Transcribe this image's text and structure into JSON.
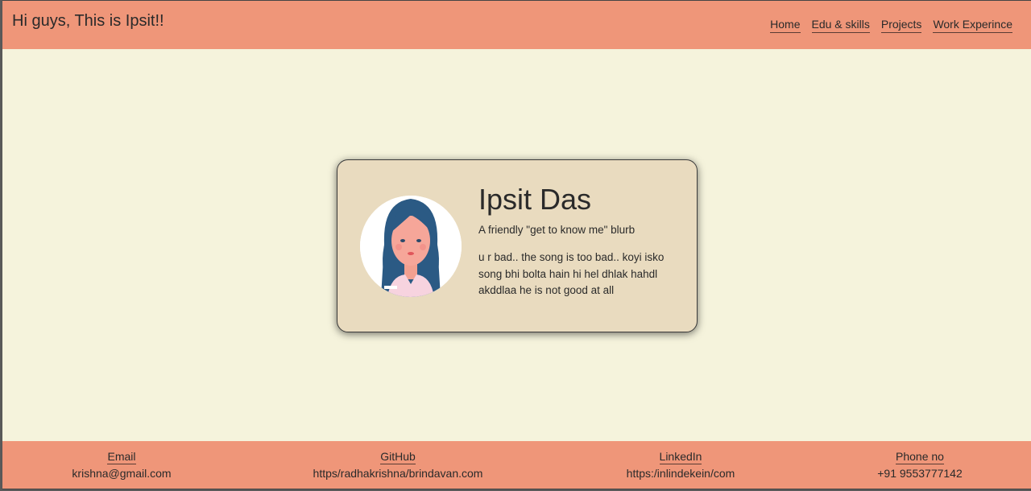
{
  "header": {
    "title": "Hi guys, This is Ipsit!!",
    "nav": [
      "Home",
      "Edu & skills",
      "Projects",
      "Work Experince"
    ]
  },
  "card": {
    "avatar_icon": "girl-avatar-icon",
    "name": "Ipsit Das",
    "blurb": "A friendly \"get to know me\" blurb",
    "bio": "u r bad.. the song is too bad.. koyi isko song bhi bolta hain hi hel dhlak hahdl akddlaa he is not good at all"
  },
  "footer": {
    "items": [
      {
        "label": "Email",
        "value": "krishna@gmail.com"
      },
      {
        "label": "GitHub",
        "value": "https/radhakrishna/brindavan.com"
      },
      {
        "label": "LinkedIn",
        "value": "https:/inlindekein/com"
      },
      {
        "label": "Phone no",
        "value": "+91 9553777142"
      }
    ]
  },
  "colors": {
    "header_bg": "#ef9679",
    "page_bg": "#f5f3dc",
    "card_bg": "#e9dbbf"
  }
}
